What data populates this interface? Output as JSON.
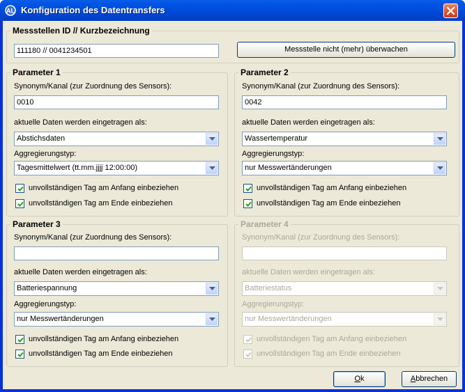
{
  "window": {
    "title": "Konfiguration des Datentransfers"
  },
  "station": {
    "group_title": "Messstellen ID // Kurzbezeichnung",
    "id_value": "111180 // 0041234501",
    "unwatch_button": "Messstelle nicht (mehr) überwachen"
  },
  "parameters": [
    {
      "title": "Parameter 1",
      "enabled": true,
      "synonym_label": "Synonym/Kanal (zur Zuordnung des Sensors):",
      "synonym_value": "0010",
      "data_label": "aktuelle Daten werden eingetragen als:",
      "data_value": "Abstichsdaten",
      "agg_label": "Aggregierungstyp:",
      "agg_value": "Tagesmittelwert (tt.mm.jjjj 12:00:00)",
      "check_start": {
        "label": "unvollständigen Tag am Anfang einbeziehen",
        "checked": true
      },
      "check_end": {
        "label": "unvollständigen Tag am Ende einbeziehen",
        "checked": true
      }
    },
    {
      "title": "Parameter 2",
      "enabled": true,
      "synonym_label": "Synonym/Kanal (zur Zuordnung des Sensors):",
      "synonym_value": "0042",
      "data_label": "aktuelle Daten werden eingetragen als:",
      "data_value": "Wassertemperatur",
      "agg_label": "Aggregierungstyp:",
      "agg_value": "nur Messwertänderungen",
      "check_start": {
        "label": "unvollständigen Tag am Anfang einbeziehen",
        "checked": true
      },
      "check_end": {
        "label": "unvollständigen Tag am Ende einbeziehen",
        "checked": true
      }
    },
    {
      "title": "Parameter 3",
      "enabled": true,
      "synonym_label": "Synonym/Kanal (zur Zuordnung des Sensors):",
      "synonym_value": "",
      "data_label": "aktuelle Daten werden eingetragen als:",
      "data_value": "Batteriespannung",
      "agg_label": "Aggregierungstyp:",
      "agg_value": "nur Messwertänderungen",
      "check_start": {
        "label": "unvollständigen Tag am Anfang einbeziehen",
        "checked": true
      },
      "check_end": {
        "label": "unvollständigen Tag am Ende einbeziehen",
        "checked": true
      }
    },
    {
      "title": "Parameter 4",
      "enabled": false,
      "synonym_label": "Synonym/Kanal (zur Zuordnung des Sensors):",
      "synonym_value": "",
      "data_label": "aktuelle Daten werden eingetragen als:",
      "data_value": "Batteriestatus",
      "agg_label": "Aggregierungstyp:",
      "agg_value": "nur Messwertänderungen",
      "check_start": {
        "label": "unvollständigen Tag am Anfang einbeziehen",
        "checked": true
      },
      "check_end": {
        "label": "unvollständigen Tag am Ende einbeziehen",
        "checked": true
      }
    }
  ],
  "buttons": {
    "ok_accel": "O",
    "ok_rest": "k",
    "cancel_accel": "A",
    "cancel_rest": "bbrechen"
  },
  "icons": {
    "app": "app-logo-icon",
    "close": "close-icon",
    "dropdown": "chevron-down-icon",
    "check": "checkmark-icon"
  },
  "colors": {
    "titlebar": "#0054e3",
    "client": "#ece9d8",
    "close_button": "#d9532b",
    "disabled_text": "#aca899"
  }
}
